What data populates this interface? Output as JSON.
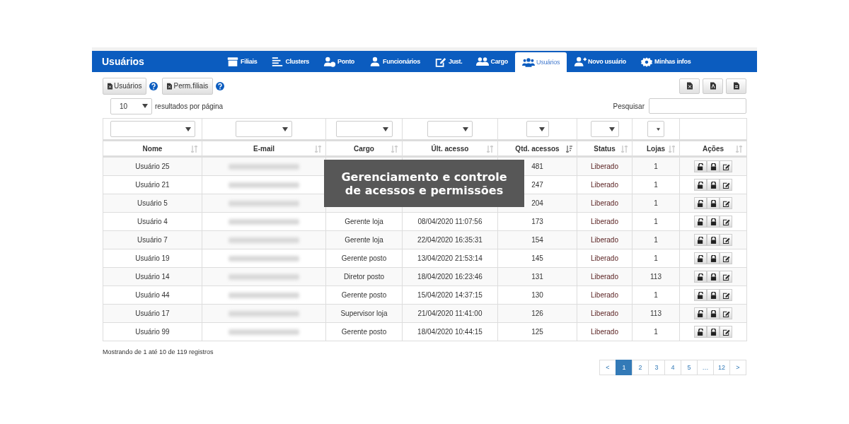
{
  "header": {
    "title": "Usuários",
    "nav": [
      {
        "label": "Filiais",
        "selected": false
      },
      {
        "label": "Clusters",
        "selected": false
      },
      {
        "label": "Ponto",
        "selected": false
      },
      {
        "label": "Funcionários",
        "selected": false
      },
      {
        "label": "Just.",
        "selected": false
      },
      {
        "label": "Cargo",
        "selected": false
      },
      {
        "label": "Usuários",
        "selected": true
      },
      {
        "label": "Novo usuário",
        "selected": false
      },
      {
        "label": "Minhas infos",
        "selected": false
      }
    ]
  },
  "export_buttons": [
    {
      "label": "Usuários"
    },
    {
      "label": "Perm.filiais"
    }
  ],
  "page_size": {
    "value": "10",
    "label": "resultados por página"
  },
  "search": {
    "label": "Pesquisar"
  },
  "columns": [
    {
      "label": "Nome",
      "sorted": false,
      "filter": true
    },
    {
      "label": "E-mail",
      "sorted": false,
      "filter": true
    },
    {
      "label": "Cargo",
      "sorted": false,
      "filter": true
    },
    {
      "label": "Últ. acesso",
      "sorted": false,
      "filter": true
    },
    {
      "label": "Qtd. acessos",
      "sorted": true,
      "filter": true
    },
    {
      "label": "Status",
      "sorted": false,
      "filter": true
    },
    {
      "label": "Lojas",
      "sorted": false,
      "filter": true
    },
    {
      "label": "Ações",
      "sorted": false,
      "filter": false
    }
  ],
  "rows": [
    {
      "name": "Usuário 25",
      "count": "481",
      "status": "Liberado",
      "stores": "1"
    },
    {
      "name": "Usuário 21",
      "count": "247",
      "status": "Liberado",
      "stores": "1"
    },
    {
      "name": "Usuário 5",
      "count": "204",
      "status": "Liberado",
      "stores": "1"
    },
    {
      "name": "Usuário 4",
      "cargo": "Gerente loja",
      "last": "08/04/2020 11:07:56",
      "count": "173",
      "status": "Liberado",
      "stores": "1"
    },
    {
      "name": "Usuário 7",
      "cargo": "Gerente loja",
      "last": "22/04/2020 16:35:31",
      "count": "154",
      "status": "Liberado",
      "stores": "1"
    },
    {
      "name": "Usuário 19",
      "cargo": "Gerente posto",
      "last": "13/04/2020 21:53:14",
      "count": "145",
      "status": "Liberado",
      "stores": "1"
    },
    {
      "name": "Usuário 14",
      "cargo": "Diretor posto",
      "last": "18/04/2020 16:23:46",
      "count": "131",
      "status": "Liberado",
      "stores": "113"
    },
    {
      "name": "Usuário 44",
      "cargo": "Gerente posto",
      "last": "15/04/2020 14:37:15",
      "count": "130",
      "status": "Liberado",
      "stores": "1"
    },
    {
      "name": "Usuário 17",
      "cargo": "Supervisor loja",
      "last": "21/04/2020 11:41:00",
      "count": "126",
      "status": "Liberado",
      "stores": "113"
    },
    {
      "name": "Usuário 99",
      "cargo": "Gerente posto",
      "last": "18/04/2020 10:44:15",
      "count": "125",
      "status": "Liberado",
      "stores": "1"
    }
  ],
  "overlay": {
    "text": "Gerenciamento e controle de acessos e permissões"
  },
  "info": "Mostrando de 1 até 10 de 119 registros",
  "pagination": {
    "prev": "<",
    "next": ">",
    "pages": [
      {
        "label": "1",
        "selected": true
      },
      {
        "label": "2",
        "selected": false
      },
      {
        "label": "3",
        "selected": false
      },
      {
        "label": "4",
        "selected": false
      },
      {
        "label": "5",
        "selected": false
      },
      {
        "label": "…",
        "selected": false
      },
      {
        "label": "12",
        "selected": false
      }
    ]
  }
}
